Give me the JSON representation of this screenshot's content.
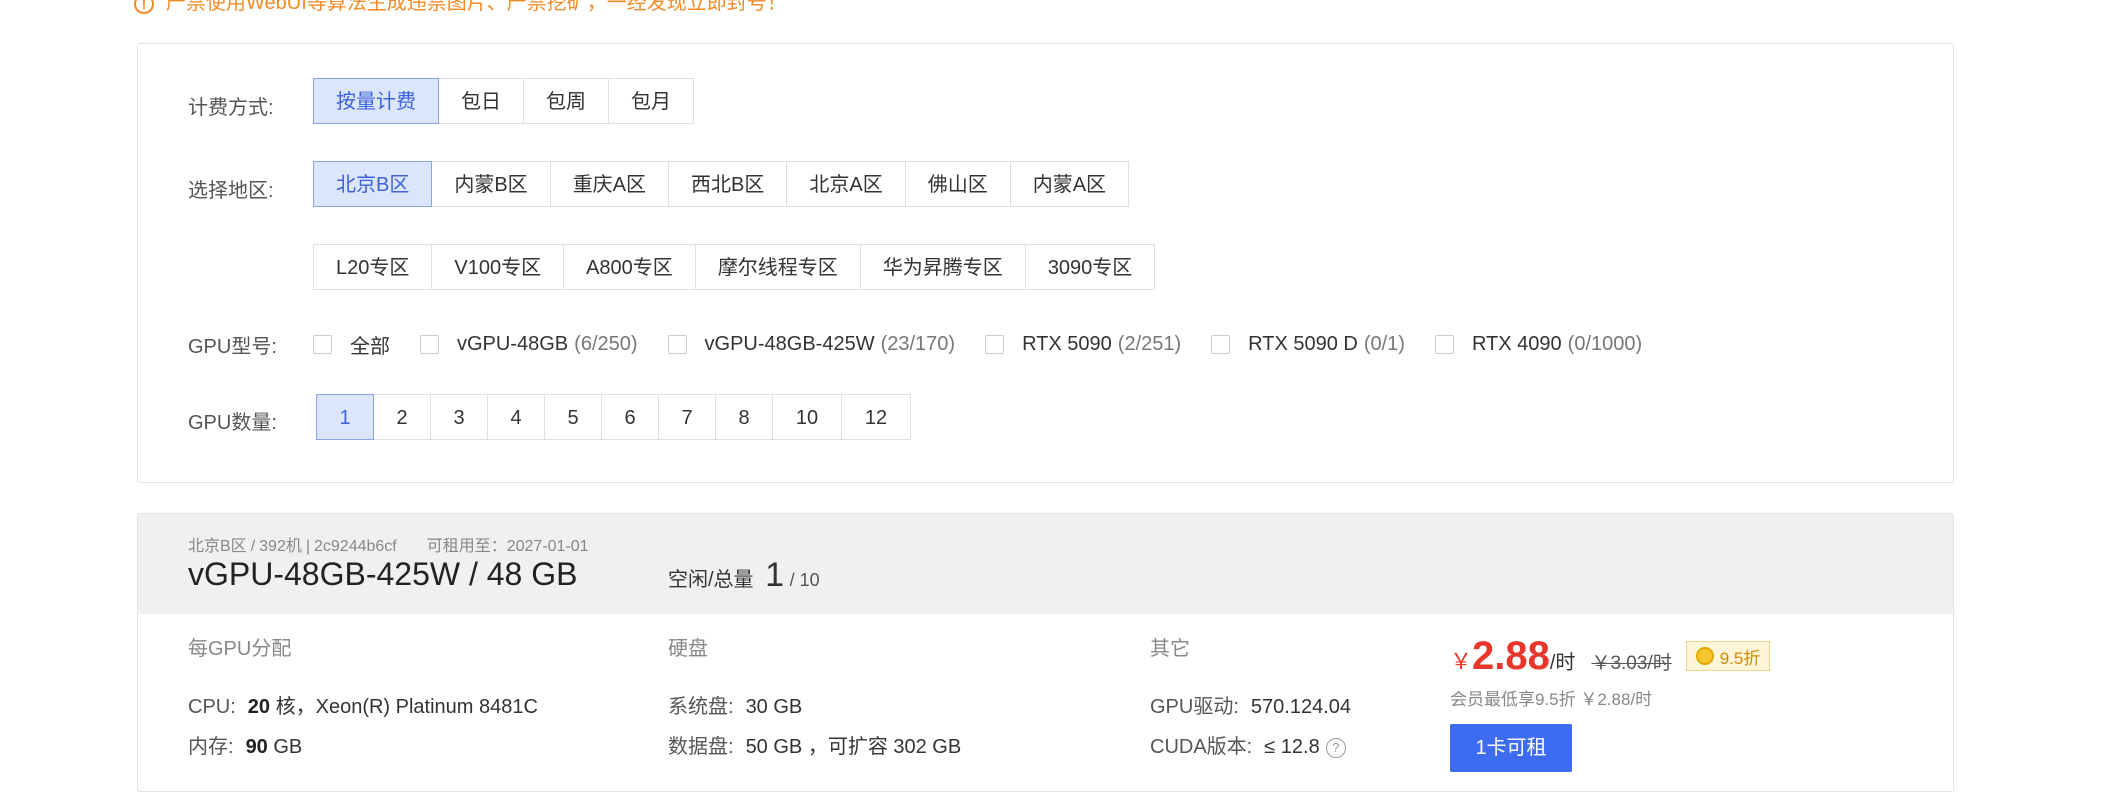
{
  "warning": {
    "text": "严禁使用WebUI等算法生成违禁图片、严禁挖矿，一经发现立即封号！"
  },
  "filters": {
    "billing": {
      "label": "计费方式:",
      "options": [
        "按量计费",
        "包日",
        "包周",
        "包月"
      ],
      "selected": "按量计费"
    },
    "region": {
      "label": "选择地区:",
      "row1": [
        "北京B区",
        "内蒙B区",
        "重庆A区",
        "西北B区",
        "北京A区",
        "佛山区",
        "内蒙A区"
      ],
      "row2": [
        "L20专区",
        "V100专区",
        "A800专区",
        "摩尔线程专区",
        "华为昇腾专区",
        "3090专区"
      ],
      "selected": "北京B区"
    },
    "gpu_type": {
      "label": "GPU型号:",
      "options": [
        {
          "name": "全部",
          "count": ""
        },
        {
          "name": "vGPU-48GB",
          "count": "(6/250)"
        },
        {
          "name": "vGPU-48GB-425W",
          "count": "(23/170)"
        },
        {
          "name": "RTX 5090",
          "count": "(2/251)"
        },
        {
          "name": "RTX 5090 D",
          "count": "(0/1)"
        },
        {
          "name": "RTX 4090",
          "count": "(0/1000)"
        }
      ]
    },
    "gpu_count": {
      "label": "GPU数量:",
      "options": [
        "1",
        "2",
        "3",
        "4",
        "5",
        "6",
        "7",
        "8",
        "10",
        "12"
      ],
      "selected": "1"
    }
  },
  "machine": {
    "region": "北京B区",
    "machine_no": "392机",
    "machine_id": "2c9244b6cf",
    "rent_until": "可租用至：2027-01-01",
    "title": "vGPU-48GB-425W / 48 GB",
    "avail_label": "空闲/总量",
    "avail_free": "1",
    "avail_total": "/ 10",
    "per_gpu": {
      "title": "每GPU分配",
      "cpu_label": "CPU:",
      "cpu_cores": "20",
      "cpu_rest": "核，Xeon(R) Platinum 8481C",
      "mem_label": "内存:",
      "mem_value": "90",
      "mem_unit": "GB"
    },
    "disk": {
      "title": "硬盘",
      "sys_label": "系统盘:",
      "sys_value": "30 GB",
      "data_label": "数据盘:",
      "data_value": "50 GB ，可扩容 302 GB"
    },
    "other": {
      "title": "其它",
      "driver_label": "GPU驱动:",
      "driver_value": "570.124.04",
      "cuda_label": "CUDA版本:",
      "cuda_value": "≤ 12.8",
      "help": "?"
    },
    "price": {
      "currency": "￥",
      "value": "2.88",
      "unit": "/时",
      "original": "￥3.03/时",
      "discount": "9.5折",
      "member_note": "会员最低享9.5折 ￥2.88/时",
      "rent_button": "1卡可租"
    }
  },
  "colors": {
    "accent": "#3d6cf0",
    "price": "#e8362b",
    "warning": "#f28a26"
  }
}
